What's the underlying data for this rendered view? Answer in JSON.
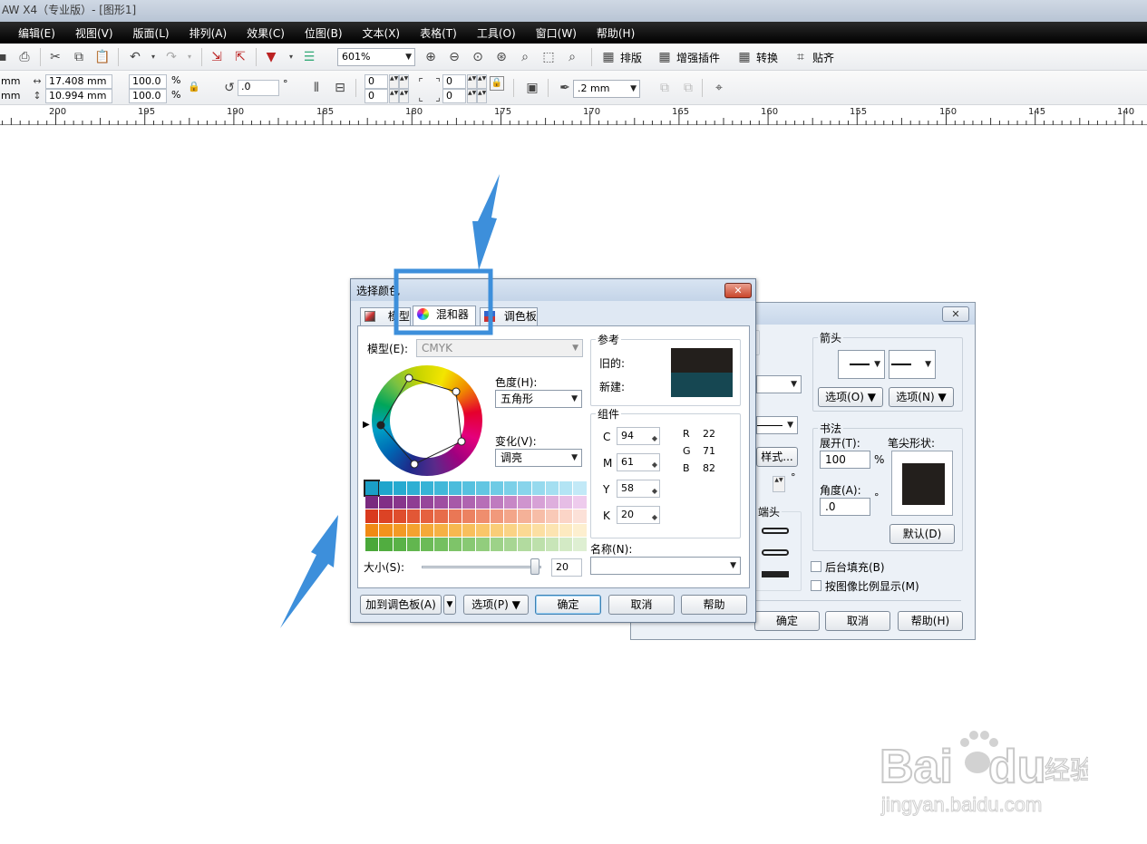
{
  "window": {
    "title": "AW X4（专业版）- [图形1]"
  },
  "menubar": {
    "items": [
      "编辑(E)",
      "视图(V)",
      "版面(L)",
      "排列(A)",
      "效果(C)",
      "位图(B)",
      "文本(X)",
      "表格(T)",
      "工具(O)",
      "窗口(W)",
      "帮助(H)"
    ]
  },
  "toolbar": {
    "zoom": "601%",
    "plugins": [
      "排版",
      "增强插件",
      "转换",
      "贴齐"
    ]
  },
  "propbar": {
    "unit_x": "mm",
    "unit_y": "mm",
    "width": "17.408 mm",
    "height": "10.994 mm",
    "scale_x": "100.0",
    "scale_y": "100.0",
    "pct": "%",
    "rotation": ".0",
    "deg": "°",
    "corner_a": "0",
    "corner_b": "0",
    "corner_c": "0",
    "corner_d": "0",
    "outline": ".2 mm"
  },
  "ruler": {
    "labels": [
      "200",
      "195",
      "190",
      "185",
      "180",
      "175",
      "170",
      "165",
      "160",
      "155",
      "150",
      "145",
      "140"
    ]
  },
  "back_dialog": {
    "arrow_group": "箭头",
    "option_left": "选项(O)",
    "option_right": "选项(N)",
    "calligraphy": "书法",
    "spread_label": "展开(T):",
    "spread_value": "100",
    "pct": "%",
    "nib_label": "笔尖形状:",
    "angle_label": "角度(A):",
    "angle_value": ".0",
    "deg": "°",
    "default_button": "默认(D)",
    "style_button": "样式...",
    "caps_label": "端头",
    "behind_fill": "后台填充(B)",
    "scale_with_image": "按图像比例显示(M)",
    "ok": "确定",
    "cancel": "取消",
    "help": "帮助(H)",
    "close": "✕"
  },
  "color_dialog": {
    "title": "选择颜色",
    "close": "✕",
    "tabs": [
      "模型",
      "混和器",
      "调色板"
    ],
    "model_label": "模型(E):",
    "model_value": "CMYK",
    "hue_label": "色度(H):",
    "hue_value": "五角形",
    "variation_label": "变化(V):",
    "variation_value": "调亮",
    "size_label": "大小(S):",
    "size_value": "20",
    "size_fraction": 0.95,
    "reference_label": "参考",
    "old_label": "旧的:",
    "new_label": "新建:",
    "old_color": "#231f1c",
    "new_color": "#164752",
    "components_label": "组件",
    "C_label": "C",
    "C": "94",
    "M_label": "M",
    "M": "61",
    "Y_label": "Y",
    "Y": "58",
    "K_label": "K",
    "K": "20",
    "R_label": "R",
    "R": "22",
    "G_label": "G",
    "G": "71",
    "B_label": "B",
    "B": "82",
    "name_label": "名称(N):",
    "add_to_palette": "加到调色板(A)",
    "options": "选项(P)",
    "ok": "确定",
    "cancel": "取消",
    "help": "帮助",
    "swatch_rows": [
      [
        "#1a9fc7",
        "#1fa5cc",
        "#26aad0",
        "#2eafd3",
        "#37b3d6",
        "#41b8d9",
        "#4bbcdc",
        "#56c1df",
        "#62c6e2",
        "#6ecbe5",
        "#7bd0e8",
        "#88d4eb",
        "#96daee",
        "#a4dff1",
        "#b3e4f4",
        "#c2e9f7"
      ],
      [
        "#7a2a7f",
        "#812f86",
        "#88368c",
        "#8f3d93",
        "#97469a",
        "#9f4fa1",
        "#a759a8",
        "#af64b0",
        "#b76fb7",
        "#bf7bbf",
        "#c787c6",
        "#cf94ce",
        "#d7a1d6",
        "#deafdd",
        "#e6bde5",
        "#eecbed"
      ],
      [
        "#d93a1e",
        "#dc4325",
        "#df4d2d",
        "#e25736",
        "#e5613f",
        "#e76c4a",
        "#ea7755",
        "#ec8261",
        "#ef8e6e",
        "#f1997b",
        "#f3a589",
        "#f5b198",
        "#f7bda7",
        "#f9c9b7",
        "#fbd5c7",
        "#fce1d8"
      ],
      [
        "#f08a14",
        "#f2921c",
        "#f39a25",
        "#f4a22f",
        "#f5a939",
        "#f6b144",
        "#f7b850",
        "#f8bf5c",
        "#f9c669",
        "#facd77",
        "#fad385",
        "#fbd993",
        "#fcdfa2",
        "#fce4b1",
        "#fdeac0",
        "#fdefcf"
      ],
      [
        "#4aa83a",
        "#51ad40",
        "#59b247",
        "#62b64f",
        "#6bbb57",
        "#74c060",
        "#7ec469",
        "#88c973",
        "#92cd7d",
        "#9dd288",
        "#a7d693",
        "#b2db9f",
        "#bde0ab",
        "#c8e5b8",
        "#d3eac5",
        "#deefd2"
      ]
    ]
  },
  "watermark": {
    "brand": "Bai狗du经验",
    "url": "jingyan.baidu.com"
  }
}
